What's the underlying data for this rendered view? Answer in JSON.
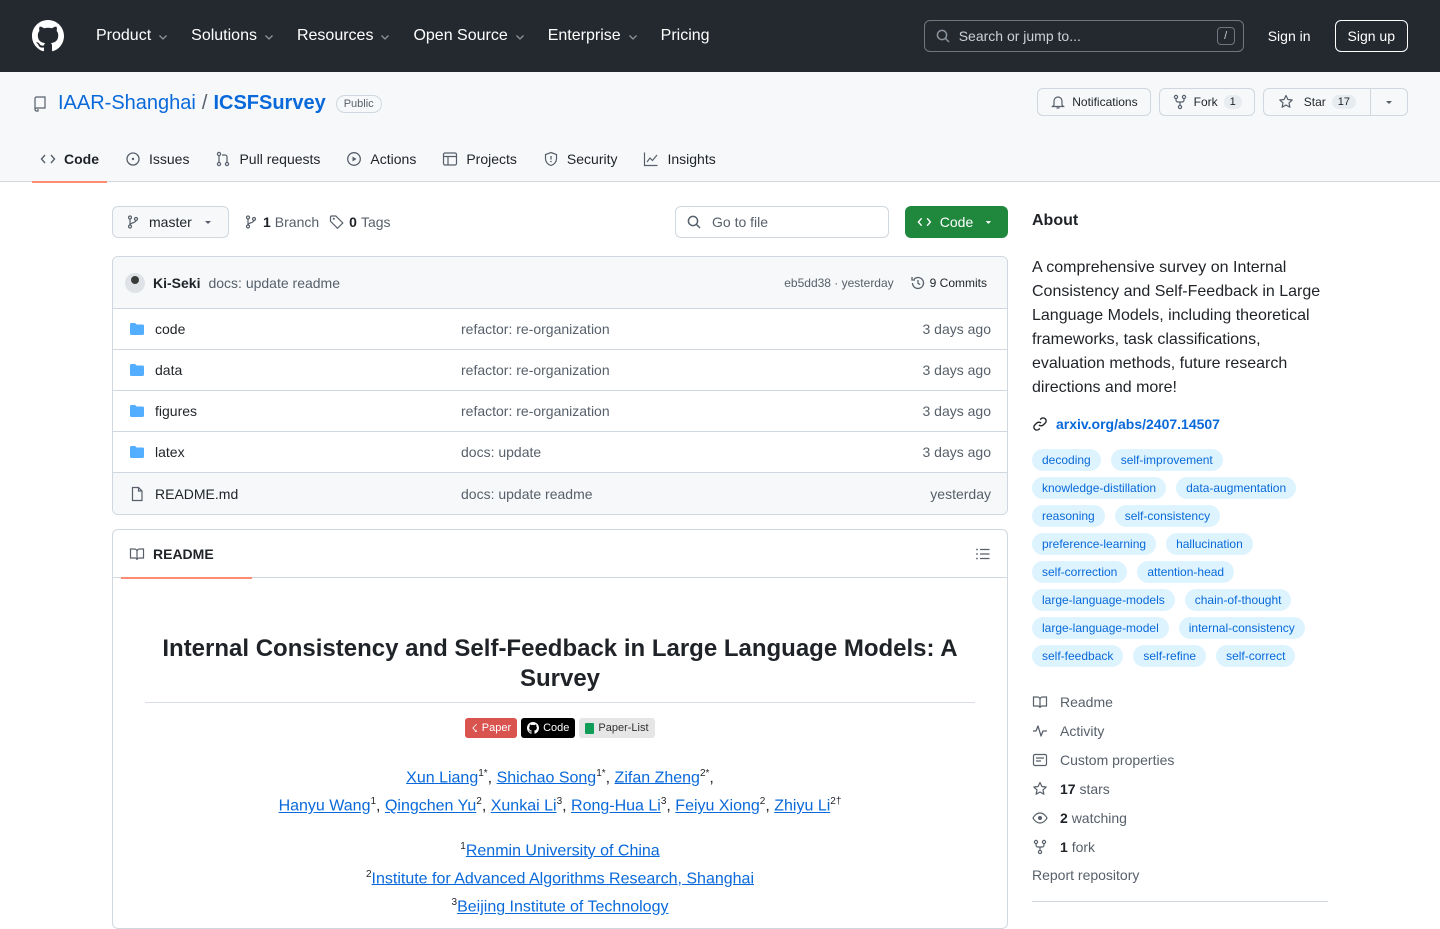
{
  "header": {
    "nav": [
      "Product",
      "Solutions",
      "Resources",
      "Open Source",
      "Enterprise",
      "Pricing"
    ],
    "search_placeholder": "Search or jump to...",
    "search_shortcut": "/",
    "signin": "Sign in",
    "signup": "Sign up"
  },
  "repo": {
    "owner": "IAAR-Shanghai",
    "separator": "/",
    "name": "ICSFSurvey",
    "visibility": "Public",
    "notifications_label": "Notifications",
    "fork_label": "Fork",
    "fork_count": "1",
    "star_label": "Star",
    "star_count": "17"
  },
  "tabs": [
    "Code",
    "Issues",
    "Pull requests",
    "Actions",
    "Projects",
    "Security",
    "Insights"
  ],
  "toolbar": {
    "branch": "master",
    "branch_count": "1",
    "branch_label": "Branch",
    "tag_count": "0",
    "tag_label": "Tags",
    "goto_placeholder": "Go to file",
    "code_button": "Code"
  },
  "commit": {
    "author": "Ki-Seki",
    "message": "docs: update readme",
    "sha_time": "eb5dd38 · yesterday",
    "commits_label": "9 Commits"
  },
  "files": [
    {
      "name": "code",
      "type": "folder",
      "message": "refactor: re-organization",
      "age": "3 days ago"
    },
    {
      "name": "data",
      "type": "folder",
      "message": "refactor: re-organization",
      "age": "3 days ago"
    },
    {
      "name": "figures",
      "type": "folder",
      "message": "refactor: re-organization",
      "age": "3 days ago"
    },
    {
      "name": "latex",
      "type": "folder",
      "message": "docs: update",
      "age": "3 days ago"
    },
    {
      "name": "README.md",
      "type": "file",
      "message": "docs: update readme",
      "age": "yesterday"
    }
  ],
  "readme": {
    "tab_label": "README",
    "title": "Internal Consistency and Self-Feedback in Large Language Models: A Survey",
    "badges": [
      "Paper",
      "Code",
      "Paper-List"
    ],
    "authors_line1": [
      {
        "name": "Xun Liang",
        "sup": "1*"
      },
      {
        "name": "Shichao Song",
        "sup": "1*"
      },
      {
        "name": "Zifan Zheng",
        "sup": "2*"
      }
    ],
    "authors_line2": [
      {
        "name": "Hanyu Wang",
        "sup": "1"
      },
      {
        "name": "Qingchen Yu",
        "sup": "2"
      },
      {
        "name": "Xunkai Li",
        "sup": "3"
      },
      {
        "name": "Rong-Hua Li",
        "sup": "3"
      },
      {
        "name": "Feiyu Xiong",
        "sup": "2"
      },
      {
        "name": "Zhiyu Li",
        "sup": "2†"
      }
    ],
    "affiliations": [
      {
        "sup": "1",
        "name": "Renmin University of China"
      },
      {
        "sup": "2",
        "name": "Institute for Advanced Algorithms Research, Shanghai"
      },
      {
        "sup": "3",
        "name": "Beijing Institute of Technology"
      }
    ]
  },
  "about": {
    "heading": "About",
    "description": "A comprehensive survey on Internal Consistency and Self-Feedback in Large Language Models, including theoretical frameworks, task classifications, evaluation methods, future research directions and more!",
    "link": "arxiv.org/abs/2407.14507",
    "topics": [
      "decoding",
      "self-improvement",
      "knowledge-distillation",
      "data-augmentation",
      "reasoning",
      "self-consistency",
      "preference-learning",
      "hallucination",
      "self-correction",
      "attention-head",
      "large-language-models",
      "chain-of-thought",
      "large-language-model",
      "internal-consistency",
      "self-feedback",
      "self-refine",
      "self-correct"
    ],
    "readme": "Readme",
    "activity": "Activity",
    "custom_properties": "Custom properties",
    "stars_count": "17",
    "stars_label": "stars",
    "watching_count": "2",
    "watching_label": "watching",
    "fork_count": "1",
    "fork_label": "fork",
    "report": "Report repository"
  },
  "colors": {
    "header_bg": "#24292f",
    "link": "#0969da",
    "code_button": "#1f883d",
    "tab_underline": "#fd8c73",
    "topic_bg": "#ddf4ff"
  }
}
